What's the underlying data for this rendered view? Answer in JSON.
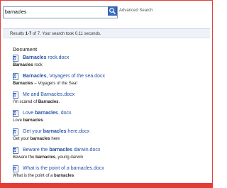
{
  "search": {
    "value": "barnacles",
    "advanced_label": "Advanced Search"
  },
  "results_summary": {
    "prefix": "Results ",
    "range": "1-7",
    "middle": " of 7. Your search took 0.11 seconds."
  },
  "section_heading": "Document",
  "results": [
    {
      "title_parts": [
        {
          "t": "Barnacles",
          "b": true
        },
        {
          "t": " rock.docx",
          "b": false
        }
      ],
      "desc_parts": [
        {
          "t": "Barnacles",
          "b": true
        },
        {
          "t": " rock",
          "b": false
        }
      ]
    },
    {
      "title_parts": [
        {
          "t": "Barnacles",
          "b": true
        },
        {
          "t": ", Voyagers of the sea.docx",
          "b": false
        }
      ],
      "desc_parts": [
        {
          "t": "Barnacles",
          "b": true
        },
        {
          "t": " – Voyagers of the Sea!",
          "b": false
        }
      ]
    },
    {
      "title_parts": [
        {
          "t": "Me and Barnacles.docx",
          "b": false
        }
      ],
      "desc_parts": [
        {
          "t": "I'm scared of ",
          "b": false
        },
        {
          "t": "Barnacles",
          "b": true
        },
        {
          "t": ".",
          "b": false
        }
      ]
    },
    {
      "title_parts": [
        {
          "t": "Love ",
          "b": false
        },
        {
          "t": "barnacles",
          "b": true
        },
        {
          "t": " .docx",
          "b": false
        }
      ],
      "desc_parts": [
        {
          "t": "Love ",
          "b": false
        },
        {
          "t": "barnacles",
          "b": true
        }
      ]
    },
    {
      "title_parts": [
        {
          "t": "Get your ",
          "b": false
        },
        {
          "t": "barnacles",
          "b": true
        },
        {
          "t": " here.docx",
          "b": false
        }
      ],
      "desc_parts": [
        {
          "t": "Get your ",
          "b": false
        },
        {
          "t": "barnacles",
          "b": true
        },
        {
          "t": " here",
          "b": false
        }
      ]
    },
    {
      "title_parts": [
        {
          "t": "Beware the ",
          "b": false
        },
        {
          "t": "barnacles",
          "b": true
        },
        {
          "t": " darwin.docx",
          "b": false
        }
      ],
      "desc_parts": [
        {
          "t": "Beware the ",
          "b": false
        },
        {
          "t": "barnacles",
          "b": true
        },
        {
          "t": ", young darwin",
          "b": false
        }
      ]
    },
    {
      "title_parts": [
        {
          "t": "What is the point of a barnacles.docx",
          "b": false
        }
      ],
      "desc_parts": [
        {
          "t": "What is the point of a ",
          "b": false
        },
        {
          "t": "barnacles",
          "b": true
        }
      ]
    }
  ],
  "colors": {
    "frame": "#e43b35",
    "link": "#1f4fa3",
    "button": "#3a6cc0"
  },
  "icons": {
    "search_button": "magnifier-icon",
    "result": "word-document-icon"
  }
}
